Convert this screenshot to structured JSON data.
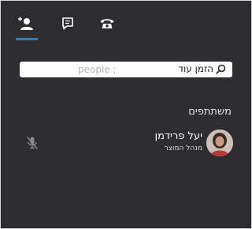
{
  "tabs": [
    {
      "name": "participants",
      "icon": "person-add-icon",
      "active": true
    },
    {
      "name": "chat",
      "icon": "chat-icon",
      "active": false
    },
    {
      "name": "call",
      "icon": "phone-icon",
      "active": false
    }
  ],
  "search": {
    "hint": "הזמן עוד",
    "ghost_text": "people ;",
    "icon": "search-icon"
  },
  "section": {
    "title": "משתתפים"
  },
  "participants": [
    {
      "name": "יעל פרידמן",
      "role": "מנהל המוצר",
      "icon": "microphone-muted-icon"
    }
  ],
  "colors": {
    "panel_bg": "#2d2d30",
    "accent": "#2e7fbf",
    "text": "#ffffff"
  }
}
